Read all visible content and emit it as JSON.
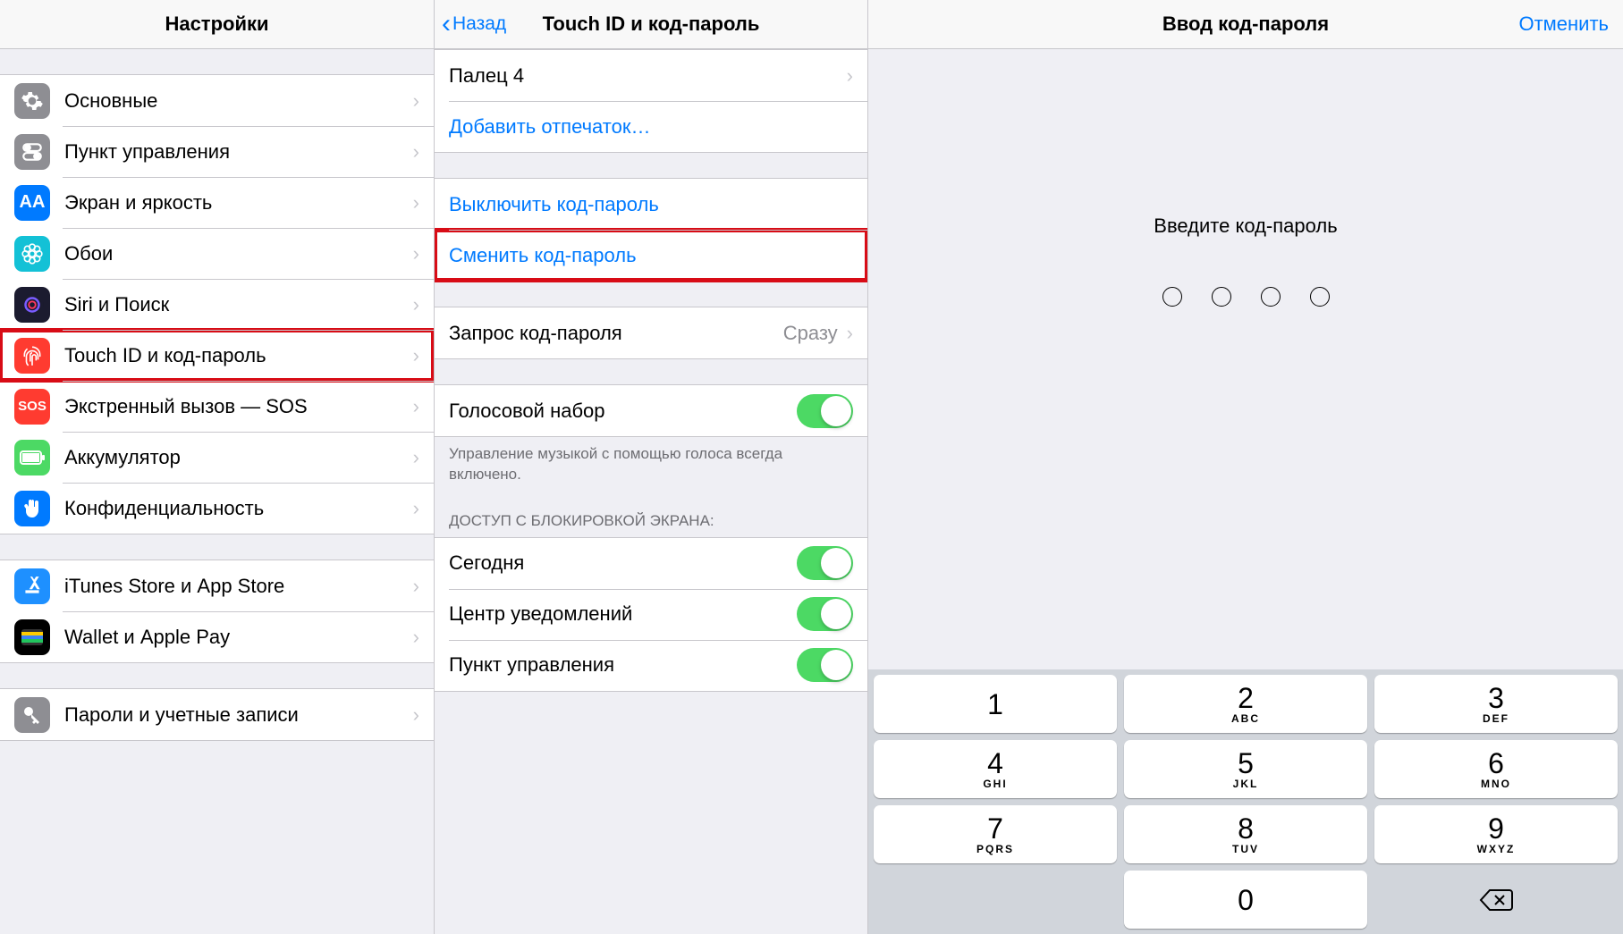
{
  "col1": {
    "title": "Настройки",
    "groups": [
      {
        "items": [
          {
            "key": "general",
            "label": "Основные",
            "icon": "gear-icon",
            "bg": "#8e8e93"
          },
          {
            "key": "control-center",
            "label": "Пункт управления",
            "icon": "switches-icon",
            "bg": "#8e8e93"
          },
          {
            "key": "display",
            "label": "Экран и яркость",
            "icon": "aa-icon",
            "bg": "#007aff"
          },
          {
            "key": "wallpaper",
            "label": "Обои",
            "icon": "flower-icon",
            "bg": "#13c1d6"
          },
          {
            "key": "siri",
            "label": "Siri и Поиск",
            "icon": "siri-icon",
            "bg": "#1b1b2f"
          },
          {
            "key": "touchid",
            "label": "Touch ID и код-пароль",
            "icon": "fingerprint-icon",
            "bg": "#ff3b30",
            "highlight": true
          },
          {
            "key": "sos",
            "label": "Экстренный вызов — SOS",
            "icon": "sos-icon",
            "bg": "#ff3b30"
          },
          {
            "key": "battery",
            "label": "Аккумулятор",
            "icon": "battery-icon",
            "bg": "#4cd964"
          },
          {
            "key": "privacy",
            "label": "Конфиденциальность",
            "icon": "hand-icon",
            "bg": "#007aff"
          }
        ]
      },
      {
        "items": [
          {
            "key": "app-store",
            "label": "iTunes Store и App Store",
            "icon": "appstore-icon",
            "bg": "#1e90ff"
          },
          {
            "key": "wallet",
            "label": "Wallet и Apple Pay",
            "icon": "wallet-icon",
            "bg": "#000"
          }
        ]
      },
      {
        "items": [
          {
            "key": "accounts",
            "label": "Пароли и учетные записи",
            "icon": "key-icon",
            "bg": "#8e8e93"
          }
        ]
      }
    ]
  },
  "col2": {
    "back": "Назад",
    "title": "Touch ID и код-пароль",
    "finger_group": {
      "items": [
        {
          "key": "finger4",
          "label": "Палец 4"
        },
        {
          "key": "add-fingerprint",
          "label": "Добавить отпечаток…",
          "link": true
        }
      ]
    },
    "passcode_group": {
      "items": [
        {
          "key": "disable-passcode",
          "label": "Выключить код-пароль",
          "link": true
        },
        {
          "key": "change-passcode",
          "label": "Сменить код-пароль",
          "link": true,
          "highlight": true
        }
      ]
    },
    "request_group": {
      "items": [
        {
          "key": "request-passcode",
          "label": "Запрос код-пароля",
          "value": "Сразу"
        }
      ]
    },
    "voice_group": {
      "items": [
        {
          "key": "voice-dial",
          "label": "Голосовой набор",
          "toggle": true
        }
      ],
      "footer": "Управление музыкой с помощью голоса всегда включено."
    },
    "lockscreen_header": "ДОСТУП С БЛОКИРОВКОЙ ЭКРАНА:",
    "lockscreen_group": {
      "items": [
        {
          "key": "today",
          "label": "Сегодня",
          "toggle": true
        },
        {
          "key": "notif-center",
          "label": "Центр уведомлений",
          "toggle": true
        },
        {
          "key": "control-center2",
          "label": "Пункт управления",
          "toggle": true
        }
      ]
    }
  },
  "col3": {
    "title": "Ввод код-пароля",
    "cancel": "Отменить",
    "prompt": "Введите код-пароль",
    "keypad": [
      {
        "d": "1",
        "l": ""
      },
      {
        "d": "2",
        "l": "ABC"
      },
      {
        "d": "3",
        "l": "DEF"
      },
      {
        "d": "4",
        "l": "GHI"
      },
      {
        "d": "5",
        "l": "JKL"
      },
      {
        "d": "6",
        "l": "MNO"
      },
      {
        "d": "7",
        "l": "PQRS"
      },
      {
        "d": "8",
        "l": "TUV"
      },
      {
        "d": "9",
        "l": "WXYZ"
      }
    ],
    "zero": "0"
  }
}
